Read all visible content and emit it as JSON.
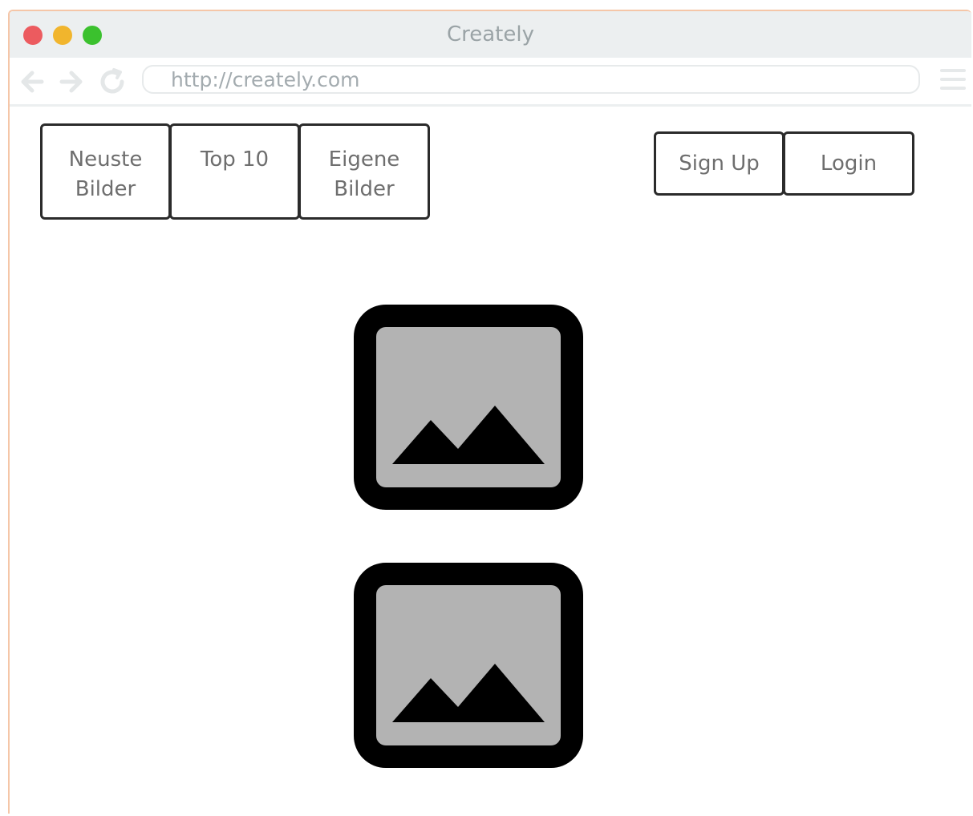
{
  "window": {
    "title": "Creately",
    "traffic_lights": {
      "close_color": "#ec5b5f",
      "minimize_color": "#f1b52d",
      "maximize_color": "#3bc12e"
    }
  },
  "toolbar": {
    "back_icon": "arrow-left-icon",
    "forward_icon": "arrow-right-icon",
    "reload_icon": "reload-icon",
    "address": "http://creately.com",
    "menu_icon": "hamburger-menu-icon"
  },
  "nav": {
    "items": [
      {
        "label_line1": "Neuste",
        "label_line2": "Bilder"
      },
      {
        "label_line1": "Top 10",
        "label_line2": ""
      },
      {
        "label_line1": "Eigene",
        "label_line2": "Bilder"
      }
    ]
  },
  "auth": {
    "signup_label": "Sign Up",
    "login_label": "Login"
  },
  "content": {
    "images": [
      {
        "icon": "image-placeholder-icon"
      },
      {
        "icon": "image-placeholder-icon"
      }
    ]
  },
  "colors": {
    "frame_accent": "#f5c6a8",
    "titlebar_bg": "#eceff0",
    "image_fill": "#b3b3b3",
    "image_frame": "#000000"
  }
}
